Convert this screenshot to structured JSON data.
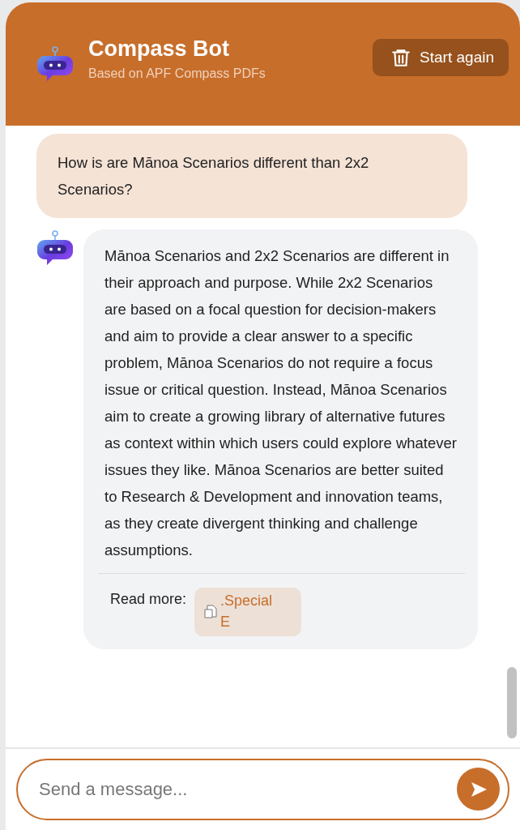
{
  "header": {
    "title": "Compass Bot",
    "subtitle": "Based on APF Compass PDFs",
    "restart_button": "Start again"
  },
  "messages": [
    {
      "kind": "user",
      "text": "How is are Mānoa Scenarios different than 2x2 Scenarios?"
    },
    {
      "kind": "bot",
      "text": "Mānoa Scenarios and 2x2 Scenarios are different in their approach and purpose. While 2x2 Scenarios are based on a focal question for decision-makers and aim to provide a clear answer to a specific problem, Mānoa Scenarios do not require a focus issue or critical question. Instead, Mānoa Scenarios aim to create a growing library of alternative futures as context within which users could explore whatever issues they like. Mānoa Scenarios are better suited to Research & Development and innovation teams, as they create divergent thinking and challenge assumptions.",
      "read_more_label": "Read more:",
      "sources": [
        ".Special E"
      ]
    }
  ],
  "composer": {
    "placeholder": "Send a message..."
  }
}
